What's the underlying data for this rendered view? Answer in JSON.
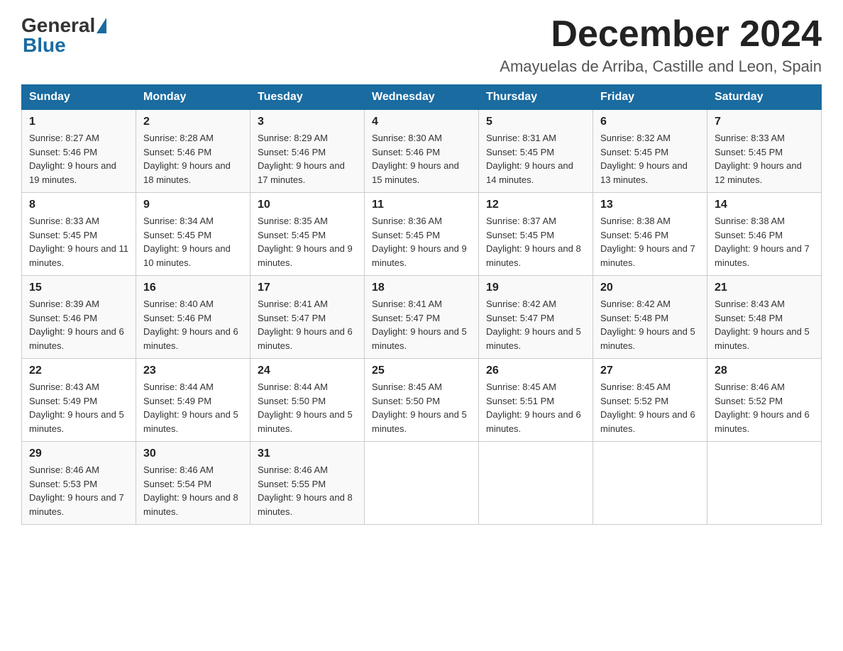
{
  "header": {
    "title": "December 2024",
    "location": "Amayuelas de Arriba, Castille and Leon, Spain"
  },
  "logo": {
    "general": "General",
    "blue": "Blue"
  },
  "days_of_week": [
    "Sunday",
    "Monday",
    "Tuesday",
    "Wednesday",
    "Thursday",
    "Friday",
    "Saturday"
  ],
  "weeks": [
    [
      {
        "num": "1",
        "sunrise": "8:27 AM",
        "sunset": "5:46 PM",
        "daylight": "9 hours and 19 minutes."
      },
      {
        "num": "2",
        "sunrise": "8:28 AM",
        "sunset": "5:46 PM",
        "daylight": "9 hours and 18 minutes."
      },
      {
        "num": "3",
        "sunrise": "8:29 AM",
        "sunset": "5:46 PM",
        "daylight": "9 hours and 17 minutes."
      },
      {
        "num": "4",
        "sunrise": "8:30 AM",
        "sunset": "5:46 PM",
        "daylight": "9 hours and 15 minutes."
      },
      {
        "num": "5",
        "sunrise": "8:31 AM",
        "sunset": "5:45 PM",
        "daylight": "9 hours and 14 minutes."
      },
      {
        "num": "6",
        "sunrise": "8:32 AM",
        "sunset": "5:45 PM",
        "daylight": "9 hours and 13 minutes."
      },
      {
        "num": "7",
        "sunrise": "8:33 AM",
        "sunset": "5:45 PM",
        "daylight": "9 hours and 12 minutes."
      }
    ],
    [
      {
        "num": "8",
        "sunrise": "8:33 AM",
        "sunset": "5:45 PM",
        "daylight": "9 hours and 11 minutes."
      },
      {
        "num": "9",
        "sunrise": "8:34 AM",
        "sunset": "5:45 PM",
        "daylight": "9 hours and 10 minutes."
      },
      {
        "num": "10",
        "sunrise": "8:35 AM",
        "sunset": "5:45 PM",
        "daylight": "9 hours and 9 minutes."
      },
      {
        "num": "11",
        "sunrise": "8:36 AM",
        "sunset": "5:45 PM",
        "daylight": "9 hours and 9 minutes."
      },
      {
        "num": "12",
        "sunrise": "8:37 AM",
        "sunset": "5:45 PM",
        "daylight": "9 hours and 8 minutes."
      },
      {
        "num": "13",
        "sunrise": "8:38 AM",
        "sunset": "5:46 PM",
        "daylight": "9 hours and 7 minutes."
      },
      {
        "num": "14",
        "sunrise": "8:38 AM",
        "sunset": "5:46 PM",
        "daylight": "9 hours and 7 minutes."
      }
    ],
    [
      {
        "num": "15",
        "sunrise": "8:39 AM",
        "sunset": "5:46 PM",
        "daylight": "9 hours and 6 minutes."
      },
      {
        "num": "16",
        "sunrise": "8:40 AM",
        "sunset": "5:46 PM",
        "daylight": "9 hours and 6 minutes."
      },
      {
        "num": "17",
        "sunrise": "8:41 AM",
        "sunset": "5:47 PM",
        "daylight": "9 hours and 6 minutes."
      },
      {
        "num": "18",
        "sunrise": "8:41 AM",
        "sunset": "5:47 PM",
        "daylight": "9 hours and 5 minutes."
      },
      {
        "num": "19",
        "sunrise": "8:42 AM",
        "sunset": "5:47 PM",
        "daylight": "9 hours and 5 minutes."
      },
      {
        "num": "20",
        "sunrise": "8:42 AM",
        "sunset": "5:48 PM",
        "daylight": "9 hours and 5 minutes."
      },
      {
        "num": "21",
        "sunrise": "8:43 AM",
        "sunset": "5:48 PM",
        "daylight": "9 hours and 5 minutes."
      }
    ],
    [
      {
        "num": "22",
        "sunrise": "8:43 AM",
        "sunset": "5:49 PM",
        "daylight": "9 hours and 5 minutes."
      },
      {
        "num": "23",
        "sunrise": "8:44 AM",
        "sunset": "5:49 PM",
        "daylight": "9 hours and 5 minutes."
      },
      {
        "num": "24",
        "sunrise": "8:44 AM",
        "sunset": "5:50 PM",
        "daylight": "9 hours and 5 minutes."
      },
      {
        "num": "25",
        "sunrise": "8:45 AM",
        "sunset": "5:50 PM",
        "daylight": "9 hours and 5 minutes."
      },
      {
        "num": "26",
        "sunrise": "8:45 AM",
        "sunset": "5:51 PM",
        "daylight": "9 hours and 6 minutes."
      },
      {
        "num": "27",
        "sunrise": "8:45 AM",
        "sunset": "5:52 PM",
        "daylight": "9 hours and 6 minutes."
      },
      {
        "num": "28",
        "sunrise": "8:46 AM",
        "sunset": "5:52 PM",
        "daylight": "9 hours and 6 minutes."
      }
    ],
    [
      {
        "num": "29",
        "sunrise": "8:46 AM",
        "sunset": "5:53 PM",
        "daylight": "9 hours and 7 minutes."
      },
      {
        "num": "30",
        "sunrise": "8:46 AM",
        "sunset": "5:54 PM",
        "daylight": "9 hours and 8 minutes."
      },
      {
        "num": "31",
        "sunrise": "8:46 AM",
        "sunset": "5:55 PM",
        "daylight": "9 hours and 8 minutes."
      },
      null,
      null,
      null,
      null
    ]
  ]
}
